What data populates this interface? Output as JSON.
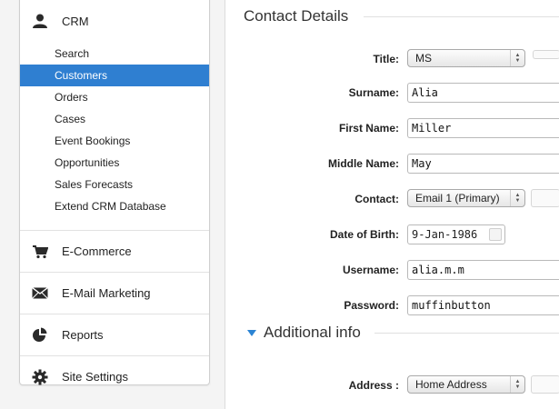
{
  "sidebar": {
    "crm": {
      "label": "CRM",
      "items": [
        {
          "label": "Search"
        },
        {
          "label": "Customers",
          "active": true
        },
        {
          "label": "Orders"
        },
        {
          "label": "Cases"
        },
        {
          "label": "Event Bookings"
        },
        {
          "label": "Opportunities"
        },
        {
          "label": "Sales Forecasts"
        },
        {
          "label": "Extend CRM Database"
        }
      ]
    },
    "sections": [
      {
        "label": "E-Commerce",
        "icon": "cart-icon"
      },
      {
        "label": "E-Mail Marketing",
        "icon": "envelope-icon"
      },
      {
        "label": "Reports",
        "icon": "pie-chart-icon"
      },
      {
        "label": "Site Settings",
        "icon": "gear-icon"
      }
    ]
  },
  "main": {
    "heading": "Contact Details",
    "fields": {
      "title": {
        "label": "Title:",
        "value": "MS"
      },
      "surname": {
        "label": "Surname:",
        "value": "Alia"
      },
      "first_name": {
        "label": "First Name:",
        "value": "Miller"
      },
      "middle_name": {
        "label": "Middle Name:",
        "value": "May"
      },
      "contact": {
        "label": "Contact:",
        "value": "Email 1 (Primary)"
      },
      "dob": {
        "label": "Date of Birth:",
        "value": "9-Jan-1986"
      },
      "username": {
        "label": "Username:",
        "value": "alia.m.m"
      },
      "password": {
        "label": "Password:",
        "value": "muffinbutton"
      },
      "address": {
        "label": "Address :",
        "value": "Home Address"
      }
    },
    "additional_info": "Additional info"
  },
  "colors": {
    "accent": "#2f7fd1",
    "triangle": "#2b84d4"
  }
}
